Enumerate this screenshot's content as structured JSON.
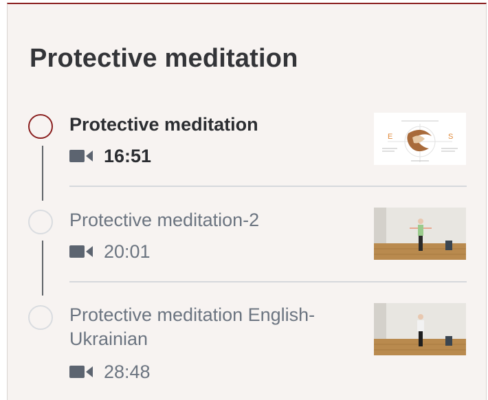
{
  "section": {
    "title": "Protective meditation"
  },
  "colors": {
    "accent": "#8a1f1f",
    "active_text": "#2b2d31",
    "muted_text": "#6b7480"
  },
  "items": [
    {
      "title": "Protective meditation",
      "duration": "16:51",
      "active": true,
      "icon": "video-camera-icon",
      "thumb": {
        "left_letter": "E",
        "right_letter": "S"
      }
    },
    {
      "title": "Protective meditation-2",
      "duration": "20:01",
      "active": false,
      "icon": "video-camera-icon"
    },
    {
      "title": "Protective meditation English-Ukrainian",
      "duration": "28:48",
      "active": false,
      "icon": "video-camera-icon"
    }
  ]
}
